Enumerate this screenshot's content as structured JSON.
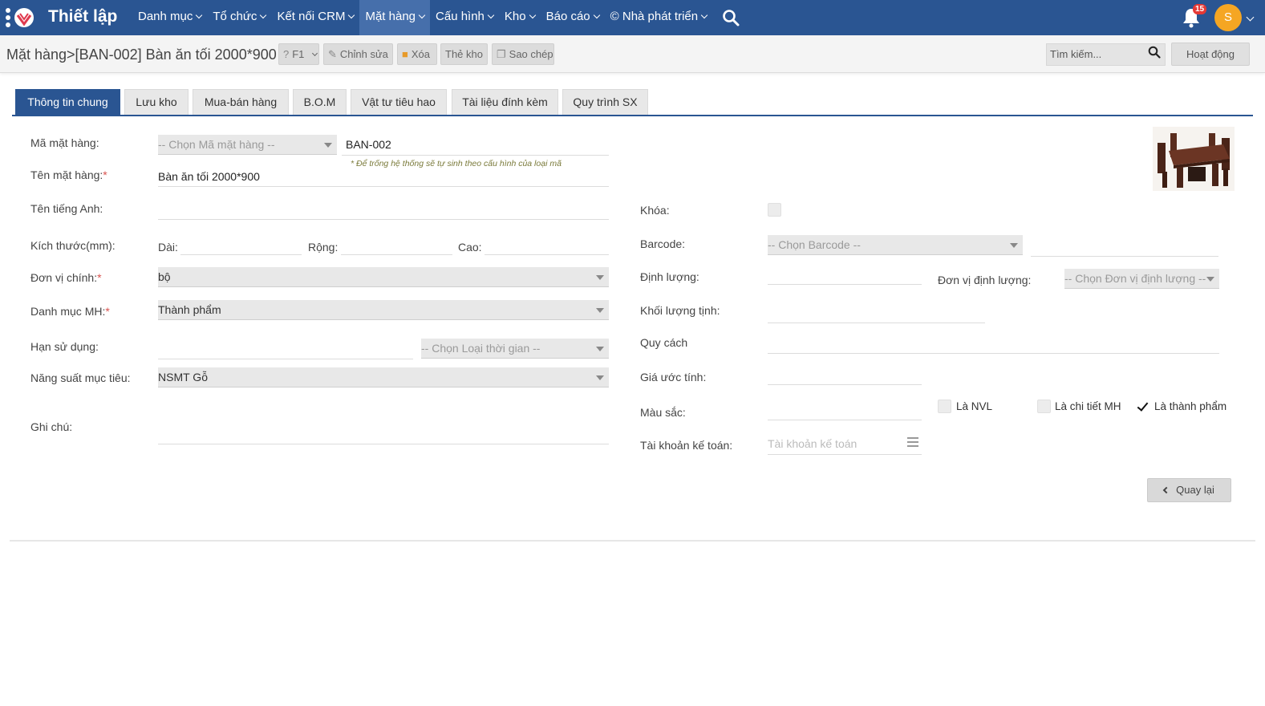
{
  "app": {
    "title": "Thiết lập"
  },
  "menu": [
    {
      "label": "Danh mục",
      "active": false
    },
    {
      "label": "Tổ chức",
      "active": false
    },
    {
      "label": "Kết nối CRM",
      "active": false
    },
    {
      "label": "Mặt hàng",
      "active": true
    },
    {
      "label": "Cấu hình",
      "active": false
    },
    {
      "label": "Kho",
      "active": false
    },
    {
      "label": "Báo cáo",
      "active": false
    },
    {
      "label": "© Nhà phát triển",
      "active": false
    }
  ],
  "notifications": {
    "count": "15"
  },
  "user": {
    "initial": "S"
  },
  "toolbar": {
    "breadcrumb": "Mặt hàng>[BAN-002] Bàn ăn tối 2000*900",
    "help_label": "F1",
    "edit_label": "Chỉnh sửa",
    "delete_label": "Xóa",
    "stock_card_label": "Thẻ kho",
    "copy_label": "Sao chép",
    "search_placeholder": "Tìm kiếm...",
    "activity_label": "Hoạt động"
  },
  "tabs": [
    {
      "label": "Thông tin chung",
      "active": true
    },
    {
      "label": "Lưu kho",
      "active": false
    },
    {
      "label": "Mua-bán hàng",
      "active": false
    },
    {
      "label": "B.O.M",
      "active": false
    },
    {
      "label": "Vật tư tiêu hao",
      "active": false
    },
    {
      "label": "Tài liệu đính kèm",
      "active": false
    },
    {
      "label": "Quy trình SX",
      "active": false
    }
  ],
  "form": {
    "code_label": "Mã mặt hàng:",
    "code_select_placeholder": "-- Chọn Mã mặt hàng --",
    "code_value": "BAN-002",
    "code_hint": "* Để trống hệ thống sẽ tự sinh theo cấu hình của loại mã",
    "name_label": "Tên mặt hàng:",
    "name_value": "Bàn ăn tối 2000*900",
    "english_name_label": "Tên tiếng Anh:",
    "size_label": "Kích thước(mm):",
    "length_label": "Dài:",
    "width_label": "Rộng:",
    "height_label": "Cao:",
    "unit_label": "Đơn vị chính:",
    "unit_value": "bộ",
    "category_label": "Danh mục MH:",
    "category_value": "Thành phẩm",
    "expiry_label": "Hạn sử dụng:",
    "time_type_placeholder": "-- Chọn Loại thời gian --",
    "target_capacity_label": "Năng suất mục tiêu:",
    "target_capacity_value": "NSMT Gỗ",
    "note_label": "Ghi chú:",
    "lock_label": "Khóa:",
    "barcode_label": "Barcode:",
    "barcode_placeholder": "-- Chọn Barcode --",
    "quantity_label": "Định lượng:",
    "quantity_unit_label": "Đơn vị định lượng:",
    "quantity_unit_placeholder": "-- Chọn Đơn vị định lượng --",
    "net_weight_label": "Khối lượng tịnh:",
    "spec_label": "Quy cách",
    "estimated_price_label": "Giá ước tính:",
    "color_label": "Màu sắc:",
    "is_material_label": "Là NVL",
    "is_material": false,
    "is_component_label": "Là chi tiết MH",
    "is_component": false,
    "is_finished_label": "Là thành phẩm",
    "is_finished": true,
    "account_label": "Tài khoản kế toán:",
    "account_placeholder": "Tài khoản kế toán",
    "back_label": "Quay lại"
  },
  "colors": {
    "brand": "#2a5592",
    "active_menu": "#466fab",
    "avatar": "#f5a623",
    "badge": "#e53935"
  }
}
